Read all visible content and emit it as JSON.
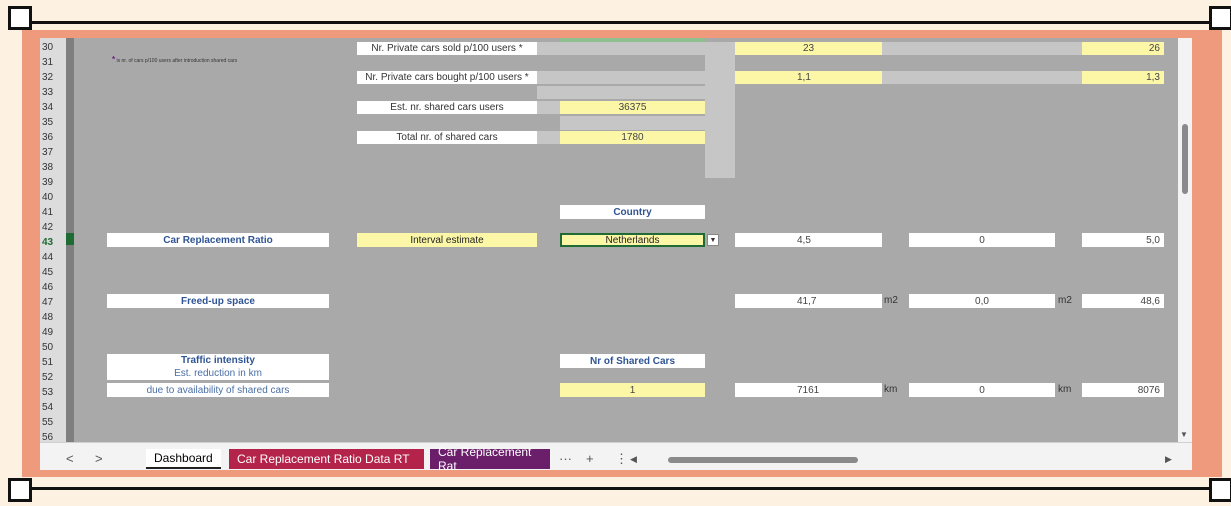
{
  "rows": [
    "30",
    "31",
    "32",
    "33",
    "34",
    "35",
    "36",
    "37",
    "38",
    "39",
    "40",
    "41",
    "42",
    "43",
    "44",
    "45",
    "46",
    "47",
    "48",
    "49",
    "50",
    "51",
    "52",
    "53",
    "54",
    "55",
    "56"
  ],
  "selected_row": "43",
  "note": {
    "star": "*",
    "text": "is nr. of cars p/100 users after introduction shared cars"
  },
  "top_block": {
    "private_sold_label": "Nr. Private cars sold p/100 users *",
    "private_bought_label": "Nr. Private cars bought p/100 users *",
    "est_users_label": "Est. nr. shared cars users",
    "est_users_value": "36375",
    "total_cars_label": "Total nr. of shared cars",
    "total_cars_value": "1780",
    "sold_v1": "23",
    "sold_v2": "26",
    "bought_v1": "1,1",
    "bought_v2": "1,3"
  },
  "country": {
    "label": "Country",
    "value": "Netherlands",
    "dropdown_icon": "chevron-down-icon"
  },
  "ratio": {
    "label": "Car Replacement Ratio",
    "interval_label": "Interval estimate",
    "v1": "4,5",
    "v2": "0",
    "v3": "5,0"
  },
  "space": {
    "label": "Freed-up space",
    "v1": "41,7",
    "unit1": "m2",
    "v2": "0,0",
    "unit2": "m2",
    "v3": "48,6"
  },
  "traffic": {
    "label": "Traffic intensity",
    "sub1": "Est. reduction in km",
    "sub2": "due to availability of shared cars",
    "shared_label": "Nr of Shared Cars",
    "shared_value": "1",
    "v1": "7161",
    "unit1": "km",
    "v2": "0",
    "unit2": "km",
    "v3": "8076"
  },
  "tabs": {
    "nav_prev": "<",
    "nav_next": ">",
    "items": [
      "Dashboard",
      "Car Replacement Ratio Data RT",
      "Car Replacement Rat"
    ],
    "more": "···",
    "add": "+",
    "menu": "⋮",
    "scroll_left": "◀",
    "scroll_right": "▶"
  },
  "scroll": {
    "down": "▼"
  }
}
